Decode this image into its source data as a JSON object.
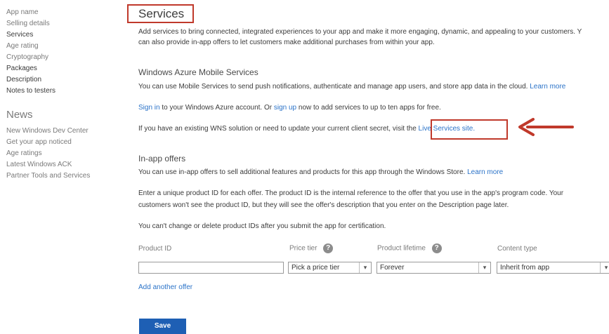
{
  "sidebar": {
    "items": [
      {
        "label": "App name",
        "emphasis": false
      },
      {
        "label": "Selling details",
        "emphasis": false
      },
      {
        "label": "Services",
        "emphasis": true
      },
      {
        "label": "Age rating",
        "emphasis": false
      },
      {
        "label": "Cryptography",
        "emphasis": false
      },
      {
        "label": "Packages",
        "emphasis": true
      },
      {
        "label": "Description",
        "emphasis": true
      },
      {
        "label": "Notes to testers",
        "emphasis": true
      }
    ]
  },
  "news": {
    "title": "News",
    "links": [
      "New Windows Dev Center",
      "Get your app noticed",
      "Age ratings",
      "Latest Windows ACK",
      "Partner Tools and Services"
    ]
  },
  "main": {
    "title": "Services",
    "intro_line1": "Add services to bring connected, integrated experiences to your app and make it more engaging, dynamic, and appealing to your customers. Y",
    "intro_line2": "can also provide in-app offers to let customers make additional purchases from within your app.",
    "azure": {
      "heading": "Windows Azure Mobile Services",
      "desc": "You can use Mobile Services to send push notifications, authenticate and manage app users, and store app data in the cloud.",
      "learn_more": "Learn more",
      "signin_link": "Sign in",
      "signin_mid": "to your Windows Azure account. Or",
      "signup_link": "sign up",
      "signin_tail": "now to add services to up to ten apps for free.",
      "wns_text": "If you have an existing WNS solution or need to update your current client secret, visit the",
      "live_link": "Live Services site."
    },
    "inapp": {
      "heading": "In-app offers",
      "desc": "You can use in-app offers to sell additional features and products for this app through the Windows Store.",
      "learn_more": "Learn more",
      "para1_line1": "Enter a unique product ID for each offer. The product ID is the internal reference to the offer that you use in the app's program code. Your",
      "para1_line2": "customers won't see the product ID, but they will see the offer's description that you enter on the Description page later.",
      "para2": "You can't change or delete product IDs after you submit the app for certification."
    },
    "form": {
      "product_id_label": "Product ID",
      "product_id_value": "",
      "price_tier_label": "Price tier",
      "price_tier_value": "Pick a price tier",
      "lifetime_label": "Product lifetime",
      "lifetime_value": "Forever",
      "content_type_label": "Content type",
      "content_type_value": "Inherit from app",
      "add_offer": "Add another offer",
      "help_glyph": "?",
      "caret_glyph": "▾"
    },
    "save_label": "Save"
  },
  "colors": {
    "accent_link": "#2b73c8",
    "annotation_red": "#c0392b",
    "button_blue": "#1e5fb4"
  }
}
